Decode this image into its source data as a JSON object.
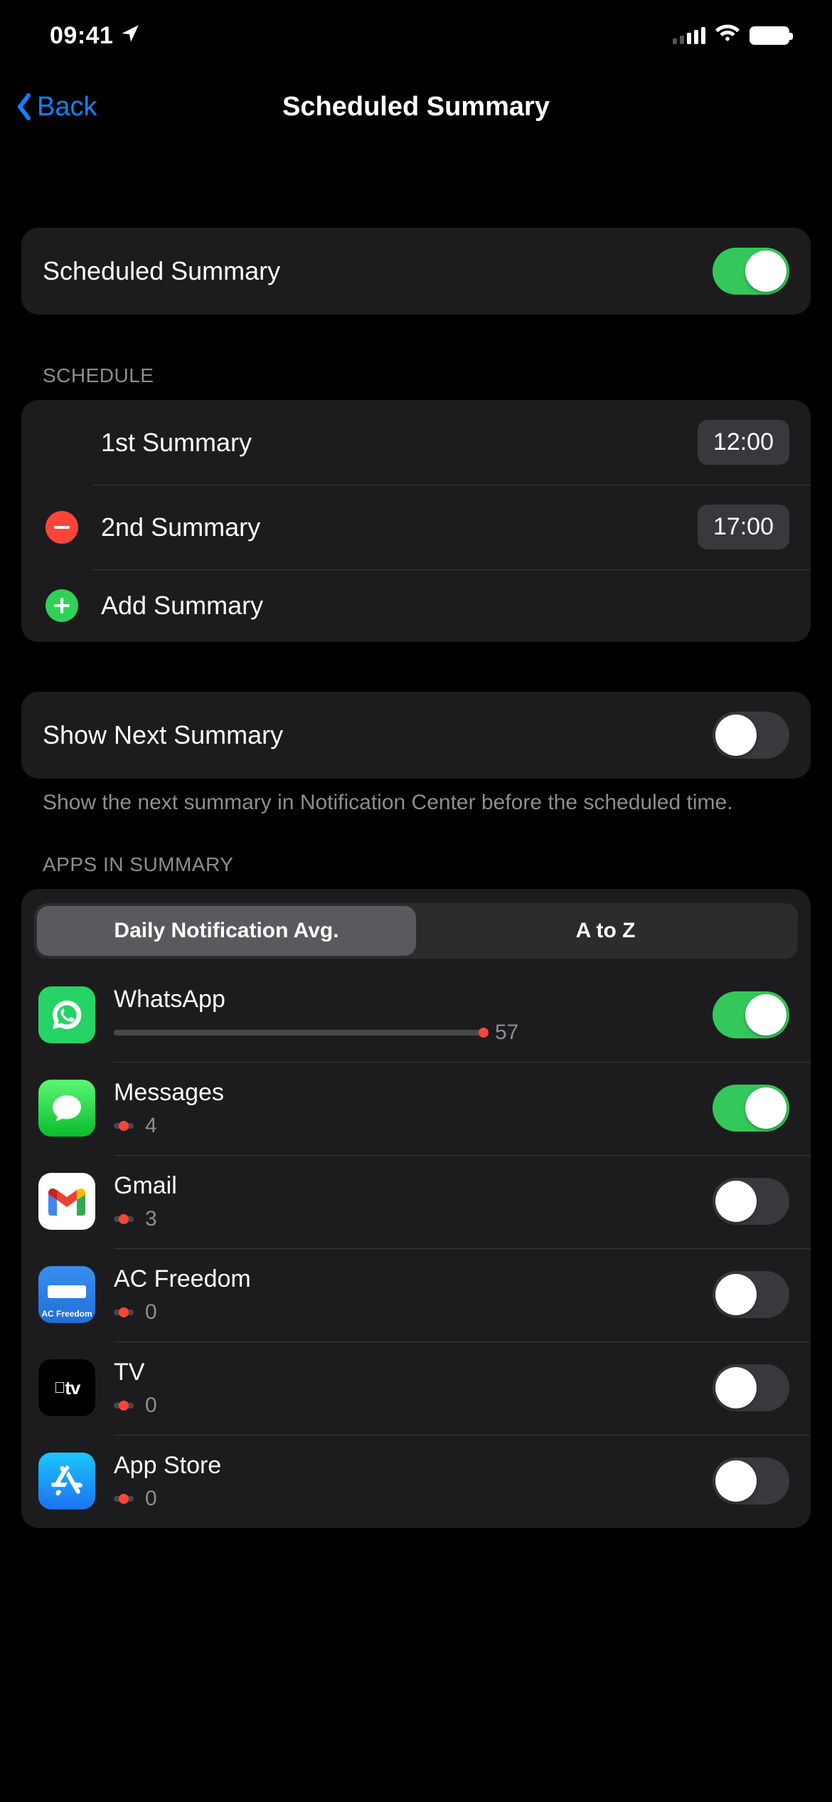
{
  "status": {
    "time": "09:41"
  },
  "nav": {
    "back_label": "Back",
    "title": "Scheduled Summary"
  },
  "main_toggle": {
    "label": "Scheduled Summary",
    "value": true
  },
  "schedule": {
    "header": "SCHEDULE",
    "items": [
      {
        "label": "1st Summary",
        "time": "12:00",
        "removable": false
      },
      {
        "label": "2nd Summary",
        "time": "17:00",
        "removable": true
      }
    ],
    "add_label": "Add Summary"
  },
  "show_next": {
    "label": "Show Next Summary",
    "value": false,
    "footer": "Show the next summary in Notification Center before the scheduled time."
  },
  "apps_section": {
    "header": "APPS IN SUMMARY",
    "segments": {
      "left": "Daily Notification Avg.",
      "right": "A to Z",
      "active": "left"
    },
    "max_count": 57,
    "apps": [
      {
        "name": "WhatsApp",
        "count": 57,
        "enabled": true,
        "icon": "whatsapp"
      },
      {
        "name": "Messages",
        "count": 4,
        "enabled": true,
        "icon": "messages"
      },
      {
        "name": "Gmail",
        "count": 3,
        "enabled": false,
        "icon": "gmail"
      },
      {
        "name": "AC Freedom",
        "count": 0,
        "enabled": false,
        "icon": "acfreedom"
      },
      {
        "name": "TV",
        "count": 0,
        "enabled": false,
        "icon": "tv"
      },
      {
        "name": "App Store",
        "count": 0,
        "enabled": false,
        "icon": "appstore"
      }
    ]
  }
}
